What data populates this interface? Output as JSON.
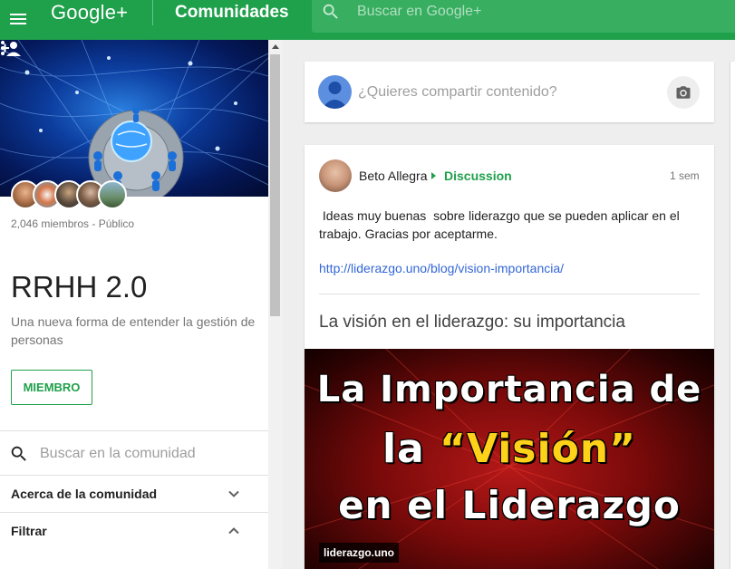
{
  "app": {
    "brand": "Google+",
    "section_title": "Comunidades",
    "search_placeholder": "Buscar en Google+"
  },
  "community": {
    "meta": "2,046 miembros - Público",
    "title": "RRHH 2.0",
    "description": "Una nueva forma de entender la gestión de personas",
    "member_button": "MIEMBRO",
    "search_placeholder": "Buscar en la comunidad",
    "sections": [
      {
        "label": "Acerca de la comunidad",
        "expanded": false
      },
      {
        "label": "Filtrar",
        "expanded": true
      }
    ]
  },
  "share": {
    "placeholder": "¿Quieres compartir contenido?"
  },
  "post": {
    "author": "Beto Allegra",
    "category": "Discussion",
    "time": "1 sem",
    "text": " Ideas muy buenas  sobre liderazgo que se pueden aplicar en el trabajo. Gracias por aceptarme.",
    "link": "http://liderazgo.uno/blog/vision-importancia/",
    "link_title": "La visión en el liderazgo: su importancia",
    "image": {
      "line1": "La Importancia de",
      "line2_prefix": "la ",
      "line2_highlight": "“Visión”",
      "line3": "en el Liderazgo",
      "badge": "liderazgo.uno"
    }
  },
  "colors": {
    "brand_green": "#1fa04b",
    "link_blue": "#3367d6"
  }
}
